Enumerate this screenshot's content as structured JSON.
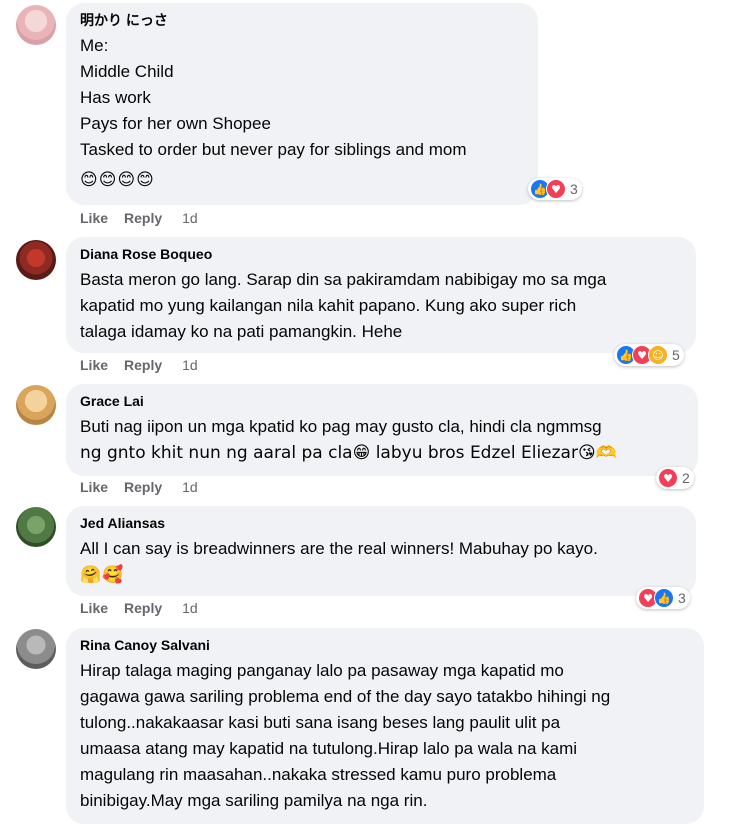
{
  "colors": {
    "bubble": "#f0f2f5",
    "like_blue": "#1877f2",
    "love_red": "#f33e58",
    "care_yellow": "#f7b125",
    "meta_gray": "#65676b"
  },
  "actions": {
    "like": "Like",
    "reply": "Reply"
  },
  "comments": [
    {
      "author": "明かり にっさ",
      "lines": [
        "Me:",
        "Middle Child",
        "Has work",
        "Pays for her own Shopee",
        "Tasked to order but never pay for siblings and mom"
      ],
      "emojis": "😊😊😊😊",
      "reactions": [
        "like-icon",
        "love-icon"
      ],
      "reaction_count": "3",
      "time": "1d"
    },
    {
      "author": "Diana Rose Boqueo",
      "lines": [
        "Basta meron go lang. Sarap din sa pakiramdam nabibigay mo sa mga",
        "kapatid mo yung kailangan nila kahit papano. Kung ako super rich",
        "talaga idamay ko na pati pamangkin. Hehe"
      ],
      "reactions": [
        "like-icon",
        "love-icon",
        "care-icon"
      ],
      "reaction_count": "5",
      "time": "1d"
    },
    {
      "author": "Grace Lai",
      "lines": [
        "Buti nag iipon un mga kpatid ko pag may gusto cla, hindi cla ngmmsg",
        "ng gnto khit nun ng aaral pa cla😁 labyu bros Edzel Eliezar😘🫶"
      ],
      "reactions": [
        "love-icon"
      ],
      "reaction_count": "2",
      "time": "1d"
    },
    {
      "author": "Jed Aliansas",
      "lines": [
        "All I can say is breadwinners are the real winners! Mabuhay po kayo."
      ],
      "emojis": "🤗🥰",
      "reactions": [
        "love-icon",
        "like-icon"
      ],
      "reaction_count": "3",
      "time": "1d"
    },
    {
      "author": "Rina Canoy Salvani",
      "lines": [
        "Hirap talaga maging panganay lalo pa pasaway mga kapatid mo",
        "gagawa gawa sariling problema end of the day sayo tatakbo hihingi ng",
        "tulong..nakakaasar kasi buti sana isang beses lang paulit ulit pa",
        "umaasa atang may kapatid na tutulong.Hirap lalo pa wala na kami",
        "magulang rin maasahan..nakaka stressed kamu puro problema",
        "binibigay.May mga sariling pamilya na nga rin."
      ]
    }
  ]
}
